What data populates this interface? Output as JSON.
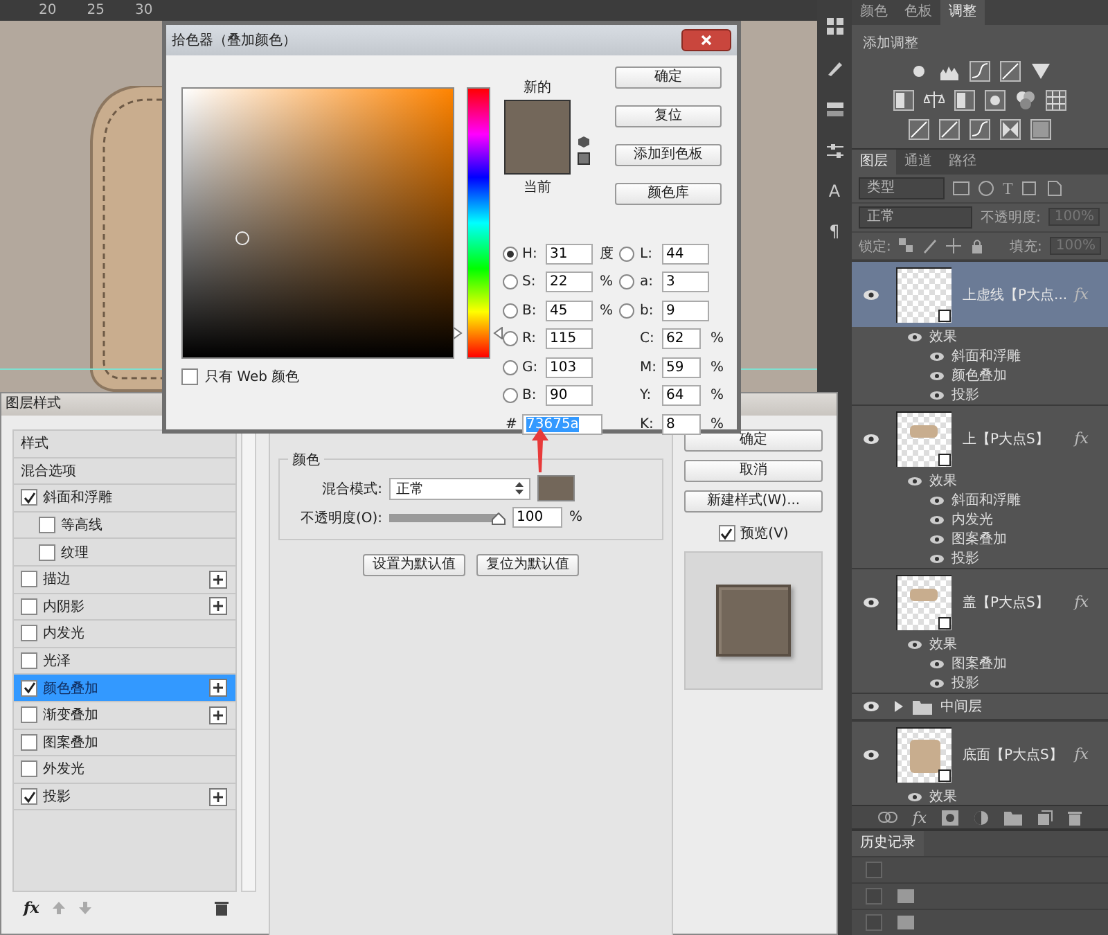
{
  "canvas": {
    "ruler_labels": [
      "20",
      "25",
      "30"
    ]
  },
  "tool_strip": {
    "glyphs": [
      "A",
      "¶"
    ]
  },
  "adjustments_panel": {
    "tabs": [
      {
        "label": "颜色",
        "selected": false
      },
      {
        "label": "色板",
        "selected": false
      },
      {
        "label": "调整",
        "selected": true
      }
    ],
    "title": "添加调整"
  },
  "layers_panel": {
    "tabs": [
      {
        "label": "图层",
        "selected": true
      },
      {
        "label": "通道",
        "selected": false
      },
      {
        "label": "路径",
        "selected": false
      }
    ],
    "filter": "类型",
    "filter_glyph": "T",
    "blend_mode": "正常",
    "opacity_label": "不透明度:",
    "opacity_value": "100%",
    "lock_label": "锁定:",
    "fill_label": "填充:",
    "fill_value": "100%",
    "layers": [
      {
        "kind": "layer",
        "name": "上虚线【P大点...",
        "selected": true,
        "thumbnail": {
          "kind": "empty"
        },
        "fx": "fx",
        "effects_label": "效果",
        "effects": [
          "斜面和浮雕",
          "颜色叠加",
          "投影"
        ]
      },
      {
        "kind": "layer",
        "name": "上【P大点S】",
        "selected": false,
        "thumbnail": {
          "kind": "shape"
        },
        "fx": "fx",
        "effects_label": "效果",
        "effects": [
          "斜面和浮雕",
          "内发光",
          "图案叠加",
          "投影"
        ]
      },
      {
        "kind": "layer",
        "name": "盖【P大点S】",
        "selected": false,
        "thumbnail": {
          "kind": "shape"
        },
        "fx": "fx",
        "effects_label": "效果",
        "effects": [
          "图案叠加",
          "投影"
        ]
      },
      {
        "kind": "group",
        "name": "中间层",
        "expanded": false
      },
      {
        "kind": "layer",
        "name": "底面【P大点S】",
        "selected": false,
        "thumbnail": {
          "kind": "square"
        },
        "fx": "fx",
        "effects_label": "效果"
      }
    ],
    "toolbar_fx": "fx"
  },
  "history_panel": {
    "title": "历史记录",
    "items": [
      {
        "checked": false
      },
      {
        "checked": false
      },
      {
        "checked": false
      }
    ]
  },
  "layer_style": {
    "title": "图层样式",
    "styles": [
      {
        "kind": "header",
        "label": "样式",
        "selected": false
      },
      {
        "kind": "header",
        "label": "混合选项",
        "selected": false
      },
      {
        "kind": "option",
        "label": "斜面和浮雕",
        "checked": true,
        "selected": false,
        "addable": false,
        "children": [
          {
            "kind": "option",
            "label": "等高线",
            "checked": false,
            "selected": false,
            "addable": false
          },
          {
            "kind": "option",
            "label": "纹理",
            "checked": false,
            "selected": false,
            "addable": false
          }
        ]
      },
      {
        "kind": "option",
        "label": "描边",
        "checked": false,
        "selected": false,
        "addable": true
      },
      {
        "kind": "option",
        "label": "内阴影",
        "checked": false,
        "selected": false,
        "addable": true
      },
      {
        "kind": "option",
        "label": "内发光",
        "checked": false,
        "selected": false,
        "addable": false
      },
      {
        "kind": "option",
        "label": "光泽",
        "checked": false,
        "selected": false,
        "addable": false
      },
      {
        "kind": "option",
        "label": "颜色叠加",
        "checked": true,
        "selected": true,
        "addable": true
      },
      {
        "kind": "option",
        "label": "渐变叠加",
        "checked": false,
        "selected": false,
        "addable": true
      },
      {
        "kind": "option",
        "label": "图案叠加",
        "checked": false,
        "selected": false,
        "addable": false
      },
      {
        "kind": "option",
        "label": "外发光",
        "checked": false,
        "selected": false,
        "addable": false
      },
      {
        "kind": "option",
        "label": "投影",
        "checked": true,
        "selected": false,
        "addable": true
      }
    ],
    "toolbar_fx": "fx",
    "group_title": "颜色",
    "blend_label": "混合模式:",
    "blend_value": "正常",
    "opacity_label": "不透明度(O):",
    "opacity": {
      "level": 1
    },
    "opacity_value": "100",
    "opacity_unit": "%",
    "default_buttons": [
      "设置为默认值",
      "复位为默认值"
    ],
    "buttons": [
      "确定",
      "取消",
      "新建样式(W)..."
    ],
    "preview": {
      "label": "预览(V)",
      "checked": true
    }
  },
  "color_picker": {
    "title": "拾色器（叠加颜色）",
    "new_label": "新的",
    "current_label": "当前",
    "buttons": [
      "确定",
      "复位",
      "添加到色板",
      "颜色库"
    ],
    "web_only": {
      "label": "只有 Web 颜色",
      "checked": false
    },
    "hue_slider": {
      "level": 0.086
    },
    "left_fields": [
      {
        "label": "H:",
        "value": "31",
        "unit": "度",
        "selected": true
      },
      {
        "label": "S:",
        "value": "22",
        "unit": "%",
        "selected": false
      },
      {
        "label": "B:",
        "value": "45",
        "unit": "%",
        "selected": false
      },
      {
        "label": "R:",
        "value": "115",
        "selected": false
      },
      {
        "label": "G:",
        "value": "103",
        "selected": false
      },
      {
        "label": "B:",
        "value": "90",
        "selected": false
      }
    ],
    "right_fields": [
      {
        "kind": "radio",
        "label": "L:",
        "value": "44",
        "selected": false
      },
      {
        "kind": "radio",
        "label": "a:",
        "value": "3",
        "selected": false
      },
      {
        "kind": "radio",
        "label": "b:",
        "value": "9",
        "selected": false
      },
      {
        "kind": "plain",
        "label": "C:",
        "value": "62",
        "unit": "%"
      },
      {
        "kind": "plain",
        "label": "M:",
        "value": "59",
        "unit": "%"
      },
      {
        "kind": "plain",
        "label": "Y:",
        "value": "64",
        "unit": "%"
      },
      {
        "kind": "plain",
        "label": "K:",
        "value": "8",
        "unit": "%"
      }
    ],
    "hex": {
      "label": "#",
      "value": "73675a",
      "highlighted": true
    }
  }
}
